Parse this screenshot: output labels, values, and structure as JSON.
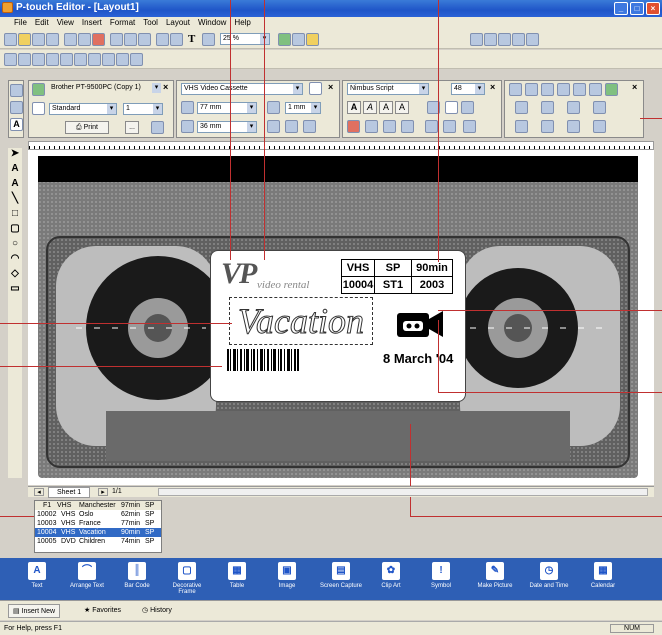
{
  "window": {
    "title": "P-touch Editor - [Layout1]"
  },
  "menu": [
    "File",
    "Edit",
    "View",
    "Insert",
    "Format",
    "Tool",
    "Layout",
    "Window",
    "Help"
  ],
  "toolbar": {
    "zoom": "25 %"
  },
  "print_panel": {
    "printer": "Brother PT-9500PC (Copy 1)",
    "mode": "Standard",
    "copies": "1",
    "print_label": "Print",
    "ellipsis": "..."
  },
  "media_panel": {
    "media": "VHS Video Cassette",
    "width": "77 mm",
    "height": "36 mm",
    "margin": "1 mm"
  },
  "font_panel": {
    "font": "Nimbus Script",
    "size": "48",
    "btn_a1": "A",
    "btn_a2": "A",
    "btn_a3": "A",
    "btn_a4": "A"
  },
  "label": {
    "brand": "VP",
    "brand_sub": "video rental",
    "title": "Vacation",
    "date": "8 March '04",
    "table": [
      [
        "VHS",
        "SP",
        "90min"
      ],
      [
        "10004",
        "ST1",
        "2003"
      ]
    ]
  },
  "sheet": {
    "name": "Sheet 1",
    "page": "1/1"
  },
  "database": {
    "header": [
      "F1",
      "VHS",
      "Manchester",
      "97min",
      "SP"
    ],
    "rows": [
      [
        "10002",
        "VHS",
        "Oslo",
        "62min",
        "SP"
      ],
      [
        "10003",
        "VHS",
        "France",
        "77min",
        "SP"
      ],
      [
        "10004",
        "VHS",
        "Vacation",
        "90min",
        "SP"
      ],
      [
        "10005",
        "DVD",
        "Children",
        "74min",
        "SP"
      ]
    ],
    "selected_row": 2
  },
  "bottom_tools": [
    "Text",
    "Arrange Text",
    "Bar Code",
    "Decorative Frame",
    "Table",
    "Image",
    "Screen Capture",
    "Clip Art",
    "Symbol",
    "Make Picture",
    "Date and Time",
    "Calendar"
  ],
  "bottom_tabs": {
    "insert_new": "Insert New",
    "favorites": "Favorites",
    "history": "History"
  },
  "status": {
    "help": "For Help, press F1",
    "num": "NUM"
  },
  "colors": {
    "title_bar": "#1f55c8",
    "bottom_bar": "#2e5fb5",
    "callout": "#c03030"
  }
}
